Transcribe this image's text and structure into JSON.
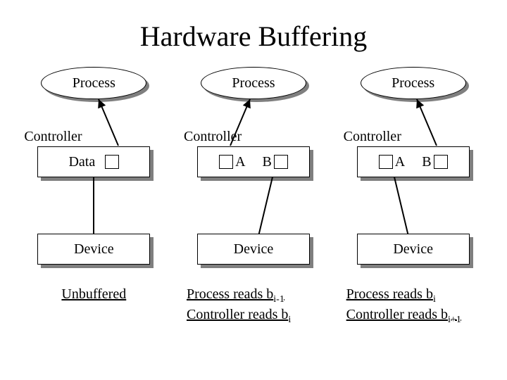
{
  "title": "Hardware Buffering",
  "columns": [
    {
      "process_label": "Process",
      "controller_label": "Controller",
      "data_mode": "single",
      "data_label": "Data",
      "device_label": "Device",
      "caption_html": "<span class='ul'>Unbuffered</span>"
    },
    {
      "process_label": "Process",
      "controller_label": "Controller",
      "data_mode": "ab",
      "buf_a": "A",
      "buf_b": "B",
      "device_label": "Device",
      "caption_html": "<span class='ul'>Process reads b<span class='sub'>i-1</span></span><br><span class='ul'>Controller reads b<span class='sub'>i</span></span>"
    },
    {
      "process_label": "Process",
      "controller_label": "Controller",
      "data_mode": "ab",
      "buf_a": "A",
      "buf_b": "B",
      "device_label": "Device",
      "caption_html": "<span class='ul'>Process reads b<span class='sub'>i</span></span><br><span class='ul'>Controller reads b<span class='sub'>i+1</span></span>"
    }
  ]
}
